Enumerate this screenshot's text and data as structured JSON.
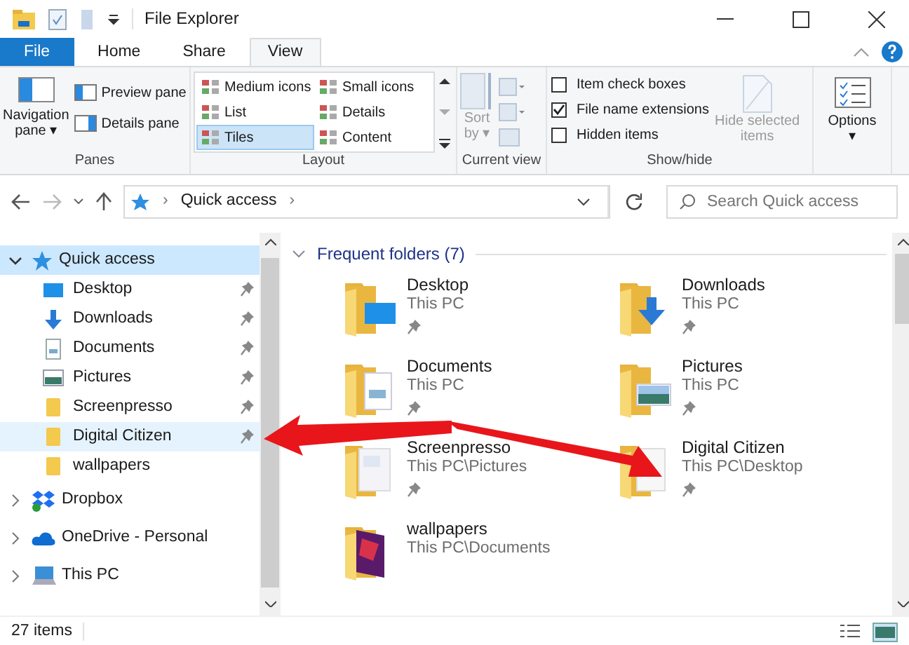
{
  "window": {
    "title": "File Explorer"
  },
  "ribbon": {
    "tabs": [
      {
        "label": "File",
        "kind": "file",
        "selected": false
      },
      {
        "label": "Home",
        "kind": "tab",
        "selected": false
      },
      {
        "label": "Share",
        "kind": "tab",
        "selected": false
      },
      {
        "label": "View",
        "kind": "tab",
        "selected": true
      }
    ],
    "panes": {
      "label": "Panes",
      "navigation_pane": [
        "Navigation",
        "pane ▾"
      ],
      "buttons": [
        "Preview pane",
        "Details pane"
      ]
    },
    "layout": {
      "label": "Layout",
      "options": [
        {
          "label": "Medium icons",
          "selected": false
        },
        {
          "label": "Small icons",
          "selected": false
        },
        {
          "label": "List",
          "selected": false
        },
        {
          "label": "Details",
          "selected": false
        },
        {
          "label": "Tiles",
          "selected": true
        },
        {
          "label": "Content",
          "selected": false
        }
      ]
    },
    "current_view": {
      "label": "Current view",
      "sort_by": [
        "Sort",
        "by ▾"
      ]
    },
    "show_hide": {
      "label": "Show/hide",
      "checkboxes": [
        {
          "label": "Item check boxes",
          "checked": false
        },
        {
          "label": "File name extensions",
          "checked": true
        },
        {
          "label": "Hidden items",
          "checked": false
        }
      ],
      "hide_selected": {
        "label": [
          "Hide selected",
          "items"
        ],
        "disabled": true
      }
    },
    "options": {
      "label": [
        "Options",
        "▾"
      ]
    }
  },
  "address_bar": {
    "segments": [
      {
        "text": "›",
        "kind": "separator"
      },
      {
        "text": "Quick access",
        "kind": "location"
      },
      {
        "text": "›",
        "kind": "separator"
      }
    ],
    "search_placeholder": "Search Quick access"
  },
  "navigation": [
    {
      "label": "Quick access",
      "kind": "star",
      "expanded": true,
      "selected": true,
      "children": [
        {
          "label": "Desktop",
          "kind": "desktop",
          "pinned": true,
          "selected": false,
          "hovered": false
        },
        {
          "label": "Downloads",
          "kind": "downloads",
          "pinned": true,
          "selected": false,
          "hovered": false
        },
        {
          "label": "Documents",
          "kind": "documents",
          "pinned": true,
          "selected": false,
          "hovered": false
        },
        {
          "label": "Pictures",
          "kind": "pictures",
          "pinned": true,
          "selected": false,
          "hovered": false
        },
        {
          "label": "Screenpresso",
          "kind": "folder",
          "pinned": true,
          "selected": false,
          "hovered": false
        },
        {
          "label": "Digital Citizen",
          "kind": "folder",
          "pinned": true,
          "selected": false,
          "hovered": true
        },
        {
          "label": "wallpapers",
          "kind": "folder",
          "pinned": false,
          "selected": false,
          "hovered": false
        }
      ]
    },
    {
      "label": "Dropbox",
      "kind": "dropbox",
      "expanded": false,
      "selected": false
    },
    {
      "label": "OneDrive - Personal",
      "kind": "onedrive",
      "expanded": false,
      "selected": false
    },
    {
      "label": "This PC",
      "kind": "pc",
      "expanded": false,
      "selected": false
    }
  ],
  "content": {
    "section": {
      "title": "Frequent folders (7)",
      "expanded": true
    },
    "folders": [
      {
        "name": "Desktop",
        "location": "This PC",
        "kind": "desktop",
        "pinned": true
      },
      {
        "name": "Downloads",
        "location": "This PC",
        "kind": "downloads",
        "pinned": true
      },
      {
        "name": "Documents",
        "location": "This PC",
        "kind": "documents",
        "pinned": true
      },
      {
        "name": "Pictures",
        "location": "This PC",
        "kind": "pictures",
        "pinned": true
      },
      {
        "name": "Screenpresso",
        "location": "This PC\\Pictures",
        "kind": "screens",
        "pinned": true
      },
      {
        "name": "Digital Citizen",
        "location": "This PC\\Desktop",
        "kind": "blank",
        "pinned": true
      },
      {
        "name": "wallpapers",
        "location": "This PC\\Documents",
        "kind": "wallpaper",
        "pinned": false
      }
    ]
  },
  "status_bar": {
    "count": "27 items"
  }
}
